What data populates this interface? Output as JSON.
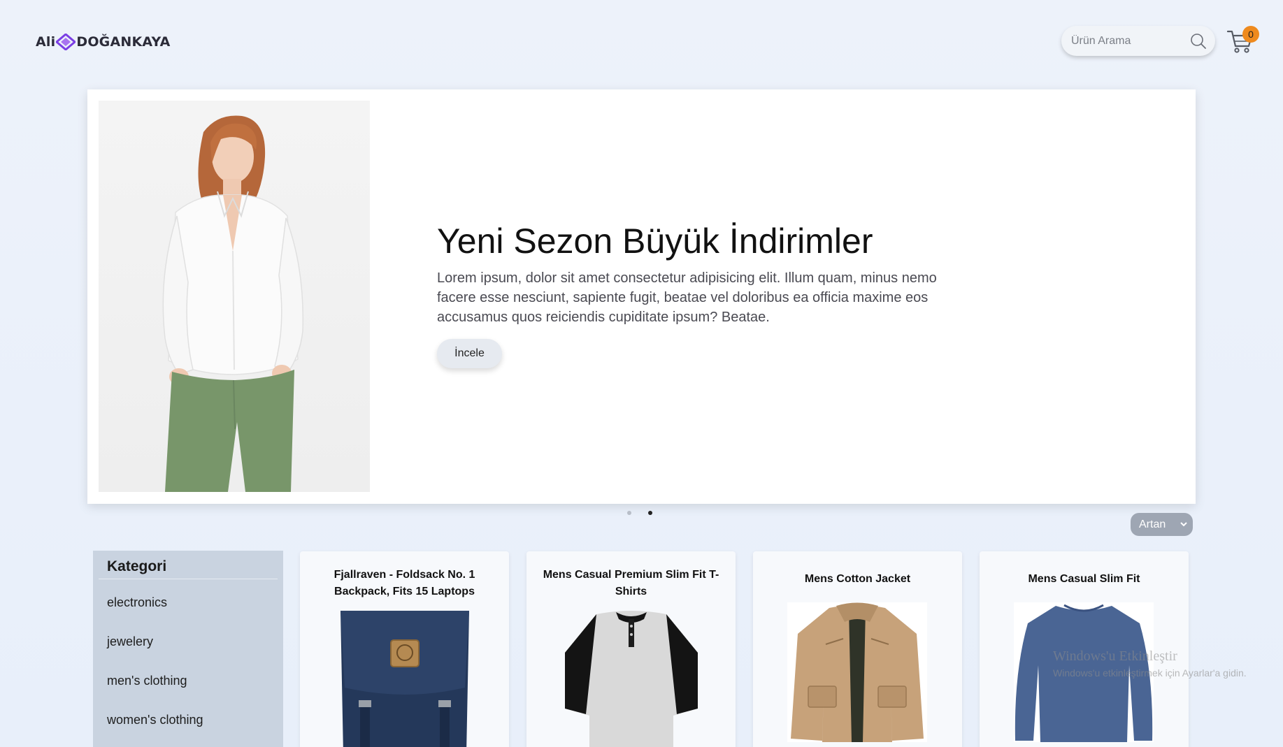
{
  "header": {
    "logo_left": "Ali",
    "logo_right": "DOĞANKAYA",
    "search_placeholder": "Ürün Arama",
    "cart_count": "0"
  },
  "hero": {
    "title": "Yeni Sezon Büyük İndirimler",
    "text": "Lorem ipsum, dolor sit amet consectetur adipisicing elit. Illum quam, minus nemo facere esse nesciunt, sapiente fugit, beatae vel doloribus ea officia maxime eos accusamus quos reiciendis cupiditate ipsum? Beatae.",
    "button_label": "İncele",
    "slides": 2,
    "active_slide": 2
  },
  "sort": {
    "selected": "Artan"
  },
  "sidebar": {
    "title": "Kategori",
    "items": [
      {
        "label": "electronics"
      },
      {
        "label": "jewelery"
      },
      {
        "label": "men's clothing"
      },
      {
        "label": "women's clothing"
      }
    ]
  },
  "products": [
    {
      "title": "Fjallraven - Foldsack No. 1 Backpack, Fits 15 Laptops"
    },
    {
      "title": "Mens Casual Premium Slim Fit T-Shirts"
    },
    {
      "title": "Mens Cotton Jacket"
    },
    {
      "title": "Mens Casual Slim Fit"
    }
  ],
  "watermark": {
    "line1": "Windows'u Etkinleştir",
    "line2": "Windows'u etkinleştirmek için Ayarlar'a gidin."
  },
  "colors": {
    "accent_purple": "#7b3fe4",
    "badge_orange": "#ee8a1e",
    "sidebar_bg": "#c9d3e0"
  }
}
